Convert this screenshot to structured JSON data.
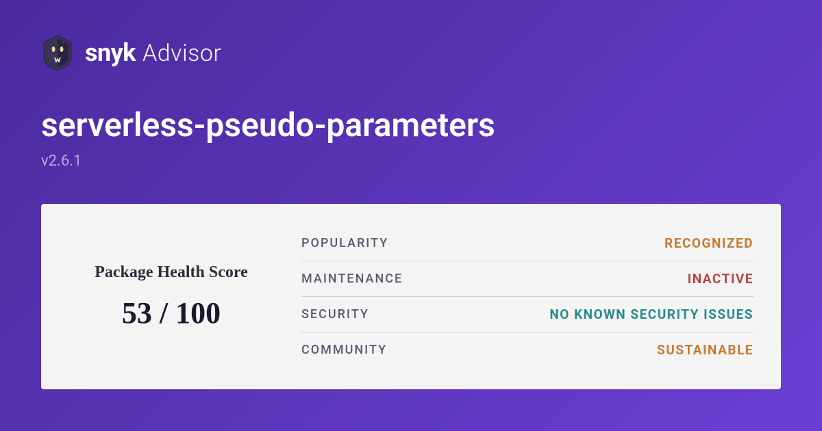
{
  "brand": {
    "name": "snyk",
    "product": "Advisor"
  },
  "package": {
    "name": "serverless-pseudo-parameters",
    "version": "v2.6.1"
  },
  "score": {
    "label": "Package Health Score",
    "value": "53 / 100"
  },
  "metrics": [
    {
      "label": "POPULARITY",
      "value": "RECOGNIZED",
      "colorClass": "color-recognized"
    },
    {
      "label": "MAINTENANCE",
      "value": "INACTIVE",
      "colorClass": "color-inactive"
    },
    {
      "label": "SECURITY",
      "value": "NO KNOWN SECURITY ISSUES",
      "colorClass": "color-noknownissues"
    },
    {
      "label": "COMMUNITY",
      "value": "SUSTAINABLE",
      "colorClass": "color-sustainable"
    }
  ]
}
